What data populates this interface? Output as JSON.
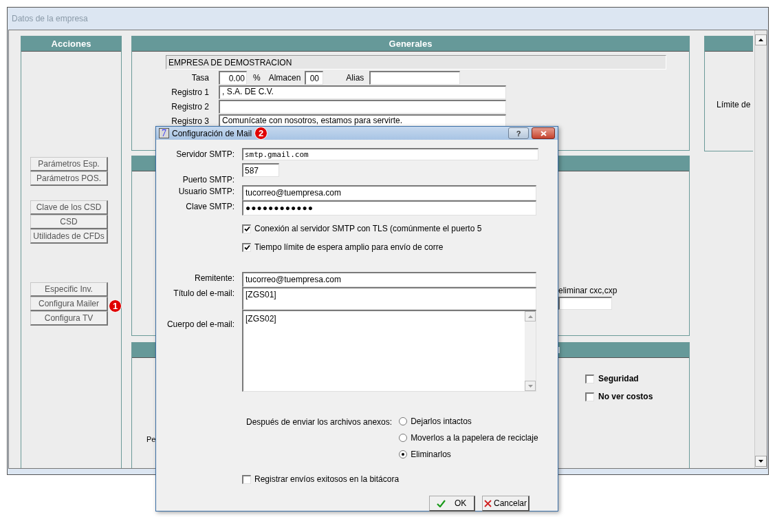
{
  "window": {
    "title": "Datos de la empresa"
  },
  "acciones": {
    "title": "Acciones",
    "groups": [
      {
        "buttons": [
          {
            "label": "Parámetros Esp."
          },
          {
            "label": "Parámetros POS."
          }
        ]
      },
      {
        "buttons": [
          {
            "label": "Clave de los CSD"
          },
          {
            "label": "CSD"
          },
          {
            "label": "Utilidades de CFDs"
          }
        ]
      },
      {
        "buttons": [
          {
            "label": "Especific Inv."
          },
          {
            "label": "Configura Mailer",
            "badge": "1"
          },
          {
            "label": "Configura TV"
          }
        ]
      }
    ]
  },
  "generales": {
    "title": "Generales",
    "company_name": "EMPRESA DE DEMOSTRACION",
    "tasa": {
      "label": "Tasa",
      "value": "0.00",
      "unit": "%"
    },
    "almacen": {
      "label": "Almacen",
      "value": "00"
    },
    "alias": {
      "label": "Alias"
    },
    "registros": [
      {
        "label": "Registro 1",
        "value": ", S.A. DE C.V."
      },
      {
        "label": "Registro 2"
      },
      {
        "label": "Registro 3",
        "value": "Comunícate con nosotros, estamos para servirte."
      }
    ]
  },
  "right_panel": {
    "label": "Límite de"
  },
  "panel_2": {
    "label": "eliminar cxc,cxp"
  },
  "panel_3": {
    "title": "l",
    "label": "Pe",
    "checkboxes": [
      {
        "label": "Seguridad",
        "checked": false
      },
      {
        "label": "No ver costos",
        "checked": false
      }
    ]
  },
  "dialog": {
    "icon_text": "7",
    "title": "Configuración de Mail",
    "badge": "2",
    "help_text": "?",
    "servidor": {
      "label": "Servidor SMTP:",
      "value": "smtp.gmail.com"
    },
    "puerto": {
      "label": "Puerto SMTP:",
      "value": "587"
    },
    "usuario": {
      "label": "Usuario SMTP:",
      "value": "tucorreo@tuempresa.com"
    },
    "clave": {
      "label": "Clave SMTP:",
      "value": "●●●●●●●●●●●●"
    },
    "options": [
      {
        "label": "Conexión al servidor SMTP con TLS (comúnmente el puerto 5",
        "checked": true
      },
      {
        "label": "Tiempo límite de espera amplio para envío de corre",
        "checked": true
      }
    ],
    "remitente": {
      "label": "Remitente:",
      "value": "tucorreo@tuempresa.com"
    },
    "titulo": {
      "label": "Título del e-mail:",
      "value": "[ZGS01]"
    },
    "cuerpo": {
      "label": "Cuerpo del e-mail:",
      "value": "[ZGS02]"
    },
    "after_send": {
      "label": "Después de enviar los archivos anexos:",
      "choices": [
        {
          "label": "Dejarlos intactos",
          "selected": false
        },
        {
          "label": "Moverlos a la papelera de reciclaje",
          "selected": false
        },
        {
          "label": "Eliminarlos",
          "selected": true
        }
      ]
    },
    "log_option": {
      "label": "Registrar envíos exitosos en la bitácora",
      "checked": false
    },
    "buttons": [
      {
        "label": "OK",
        "kind": "ok"
      },
      {
        "label": "Cancelar",
        "kind": "cancel"
      }
    ]
  }
}
